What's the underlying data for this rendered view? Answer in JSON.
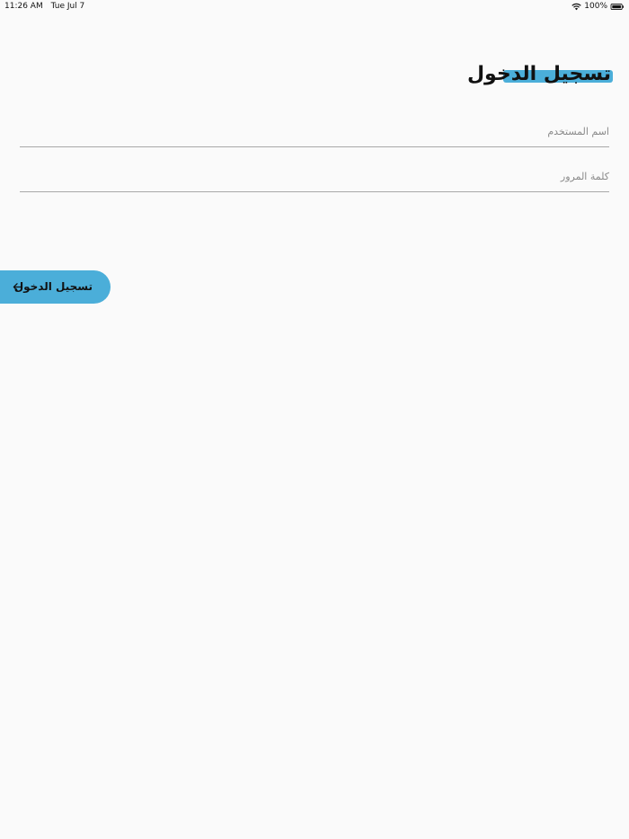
{
  "status_bar": {
    "time": "11:26 AM",
    "date": "Tue Jul 7",
    "battery": "100%",
    "icons": [
      "wifi-icon",
      "battery-icon"
    ]
  },
  "login": {
    "title": "تسجيل الدخول",
    "username_placeholder": "اسم المستخدم",
    "username_value": "",
    "password_placeholder": "كلمة المرور",
    "password_value": "",
    "button_label": "تسجيل الدخول",
    "button_icon": "arrow-left-icon"
  },
  "colors": {
    "accent": "#4baed9",
    "background": "#fafafa",
    "divider": "#a8a8a8",
    "text": "#111111",
    "placeholder": "#8a8a8a"
  }
}
